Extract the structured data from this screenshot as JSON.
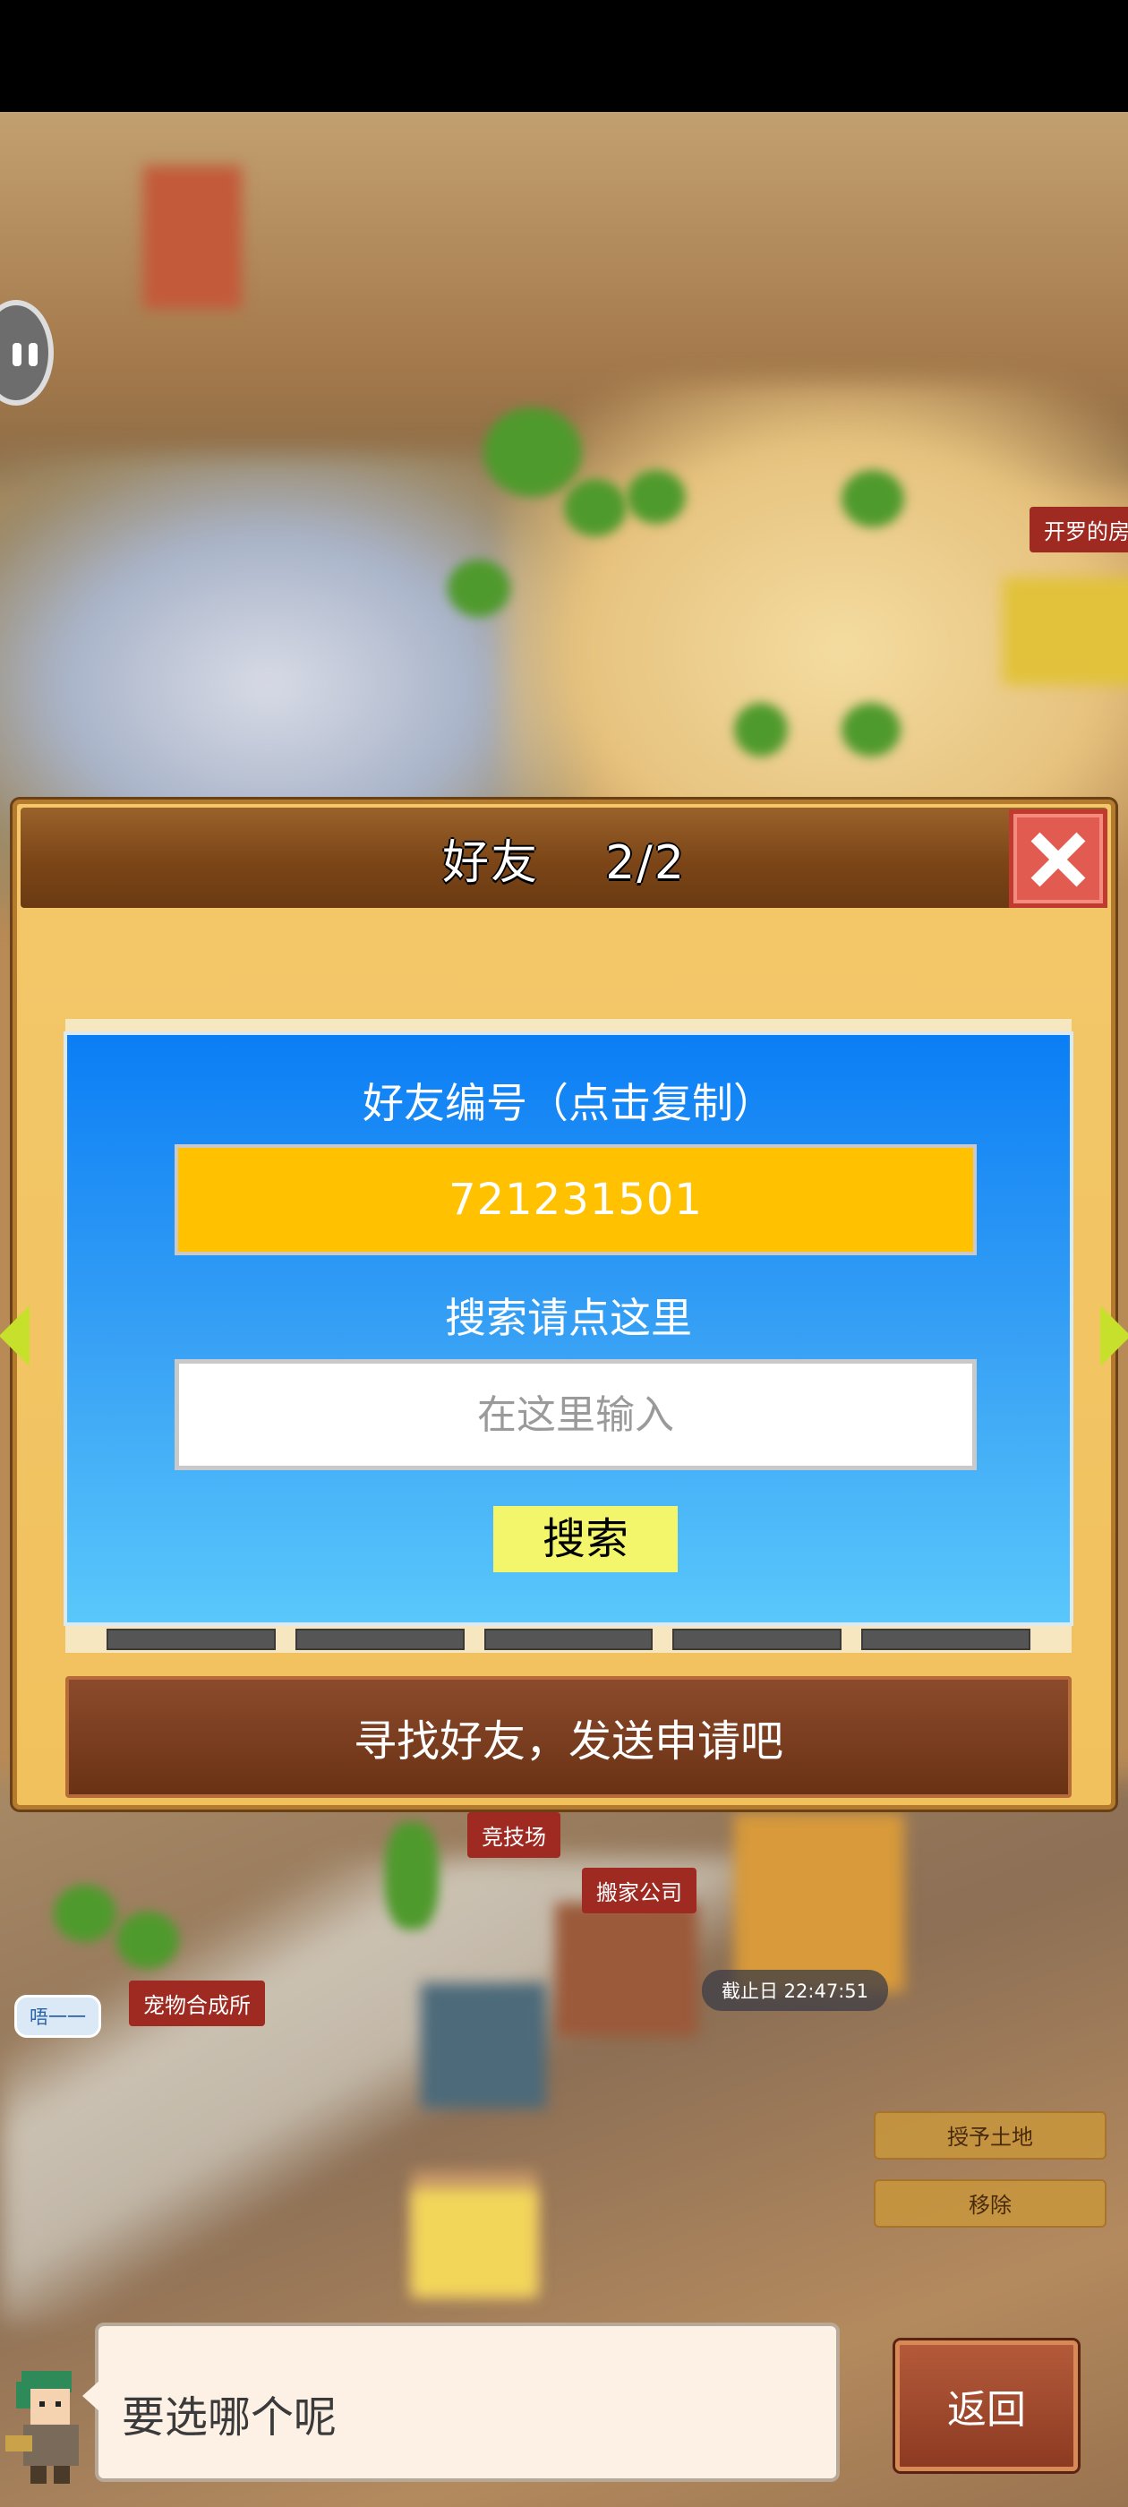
{
  "dialog": {
    "title": "好友    2/2",
    "friend_code_label": "好友编号（点击复制）",
    "friend_code": "721231501",
    "search_label": "搜索请点这里",
    "search_placeholder": "在这里输入",
    "search_button": "搜索",
    "footer_banner": "寻找好友，发送申请吧"
  },
  "map": {
    "label_top_right": "开罗的房",
    "label_arena": "竞技场",
    "label_moving_company": "搬家公司",
    "label_pet_shop": "宠物合成所",
    "deadline": "截止日 22:47:51",
    "chat_bubble": "唔一一",
    "grant_land_button": "授予土地",
    "move_button": "移除"
  },
  "dialogue": {
    "message": "要选哪个呢",
    "back_button": "返回"
  },
  "colors": {
    "panel_blue": "#0b7ef5",
    "code_yellow": "#ffc100",
    "search_button_yellow": "#f3f66b",
    "header_brown": "#7b4517",
    "close_red": "#e25b50"
  }
}
